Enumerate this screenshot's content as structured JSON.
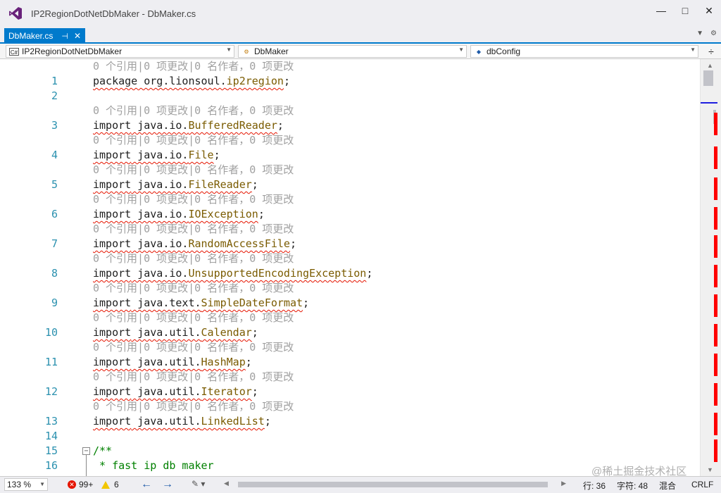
{
  "window": {
    "title": "IP2RegionDotNetDbMaker - DbMaker.cs",
    "buttons": [
      "—",
      "□",
      "✕"
    ]
  },
  "tab": {
    "label": "DbMaker.cs",
    "pin": "⊣",
    "close": "✕"
  },
  "navbar": {
    "project": "IP2RegionDotNetDbMaker",
    "project_badge": "C#",
    "type": "DbMaker",
    "member": "dbConfig"
  },
  "editor": {
    "codelens": "0 个引用|0 项更改|0 名作者，0 项更改",
    "lines": [
      {
        "n": "1",
        "kw": "package",
        "pkg": " org.lionsoul.",
        "cls": "ip2region",
        "end": ";",
        "lens": true
      },
      {
        "n": "2",
        "empty": true
      },
      {
        "n": "3",
        "kw": "import",
        "pkg": " java.io.",
        "cls": "BufferedReader",
        "end": ";",
        "lens": true
      },
      {
        "n": "4",
        "kw": "import",
        "pkg": " java.io.",
        "cls": "File",
        "end": ";",
        "lens": true
      },
      {
        "n": "5",
        "kw": "import",
        "pkg": " java.io.",
        "cls": "FileReader",
        "end": ";",
        "lens": true
      },
      {
        "n": "6",
        "kw": "import",
        "pkg": " java.io.",
        "cls": "IOException",
        "end": ";",
        "lens": true
      },
      {
        "n": "7",
        "kw": "import",
        "pkg": " java.io.",
        "cls": "RandomAccessFile",
        "end": ";",
        "lens": true
      },
      {
        "n": "8",
        "kw": "import",
        "pkg": " java.io.",
        "cls": "UnsupportedEncodingException",
        "end": ";",
        "lens": true
      },
      {
        "n": "9",
        "kw": "import",
        "pkg": " java.text.",
        "cls": "SimpleDateFormat",
        "end": ";",
        "lens": true
      },
      {
        "n": "10",
        "kw": "import",
        "pkg": " java.util.",
        "cls": "Calendar",
        "end": ";",
        "lens": true
      },
      {
        "n": "11",
        "kw": "import",
        "pkg": " java.util.",
        "cls": "HashMap",
        "end": ";",
        "lens": true
      },
      {
        "n": "12",
        "kw": "import",
        "pkg": " java.util.",
        "cls": "Iterator",
        "end": ";",
        "lens": true
      },
      {
        "n": "13",
        "kw": "import",
        "pkg": " java.util.",
        "cls": "LinkedList",
        "end": ";",
        "lens": true
      },
      {
        "n": "14",
        "empty": true
      },
      {
        "n": "15",
        "comment": "/**",
        "fold": true
      },
      {
        "n": "16",
        "comment": " * fast ip db maker"
      }
    ]
  },
  "status": {
    "zoom": "133 %",
    "errors": "99+",
    "warnings": "6",
    "line": "行: 36",
    "char": "字符: 48",
    "mode": "混合",
    "eol": "CRLF"
  },
  "watermark": "@稀土掘金技术社区",
  "colors": {
    "accent": "#007acc",
    "line_number": "#2b91af",
    "type_name": "#7a5b00",
    "comment": "#008000",
    "squiggle": "#e51400",
    "codelens": "#a0a0a0"
  }
}
